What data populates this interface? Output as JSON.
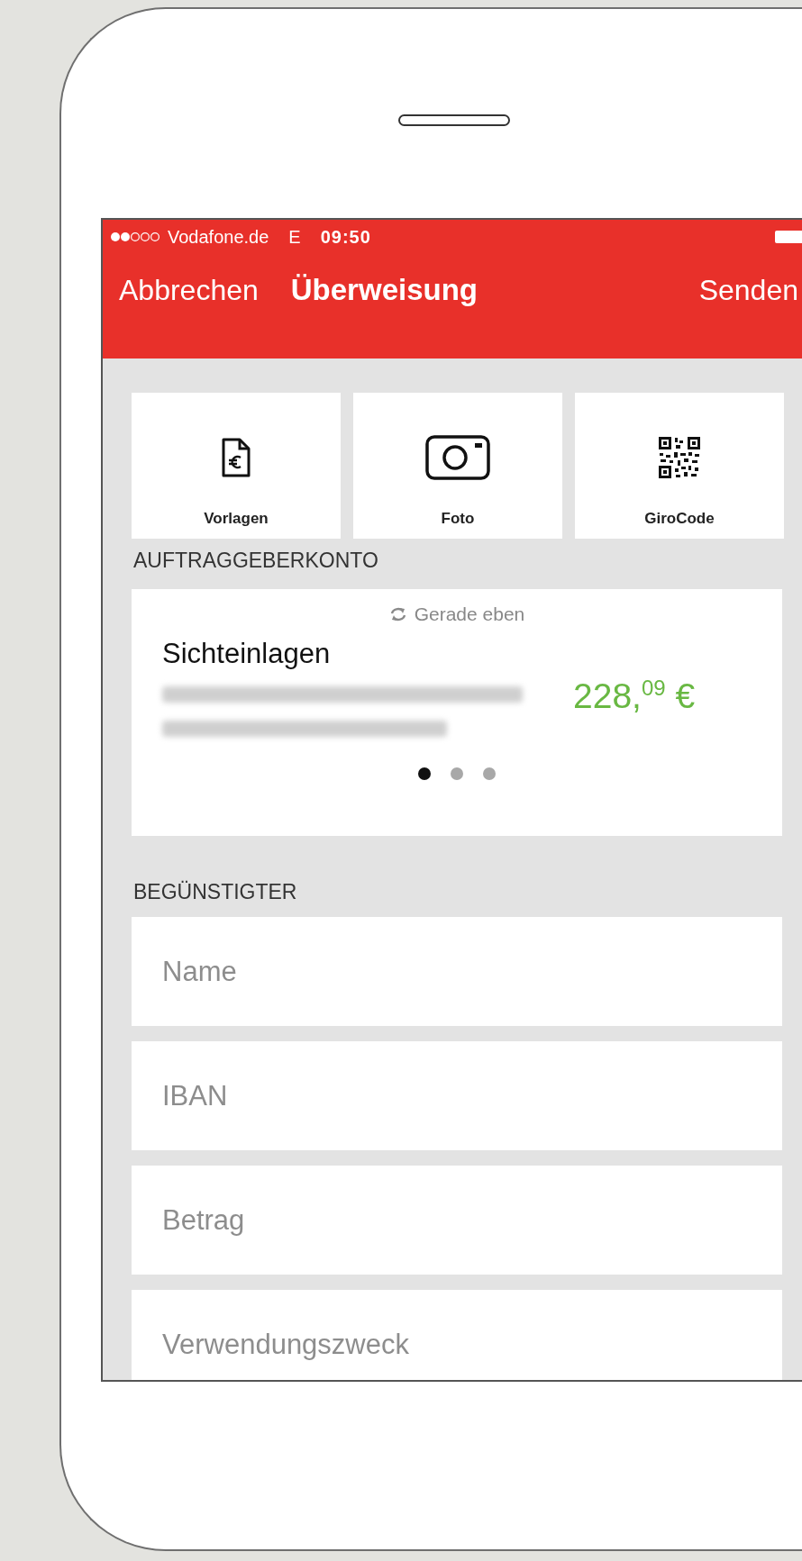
{
  "status_bar": {
    "carrier": "Vodafone.de",
    "network": "E",
    "time": "09:50"
  },
  "nav_bar": {
    "cancel": "Abbrechen",
    "title": "Überweisung",
    "send": "Senden"
  },
  "tiles": [
    {
      "kind": "template",
      "label": "Vorlagen"
    },
    {
      "kind": "photo",
      "label": "Foto"
    },
    {
      "kind": "qr",
      "label": "GiroCode"
    }
  ],
  "sender_section": {
    "header": "AUFTRAGGEBERKONTO",
    "refresh_label": "Gerade eben",
    "account_name": "Sichteinlagen",
    "balance": "228,$^{09}$ €",
    "pages": [
      {
        "selected": true
      },
      {
        "selected": false
      },
      {
        "selected": false
      }
    ]
  },
  "recipient_section": {
    "header": "BEGÜNSTIGTER",
    "fields": [
      {
        "placeholder": "Name"
      },
      {
        "placeholder": "IBAN"
      },
      {
        "placeholder": "Betrag"
      },
      {
        "placeholder": "Verwendungszweck"
      }
    ]
  }
}
